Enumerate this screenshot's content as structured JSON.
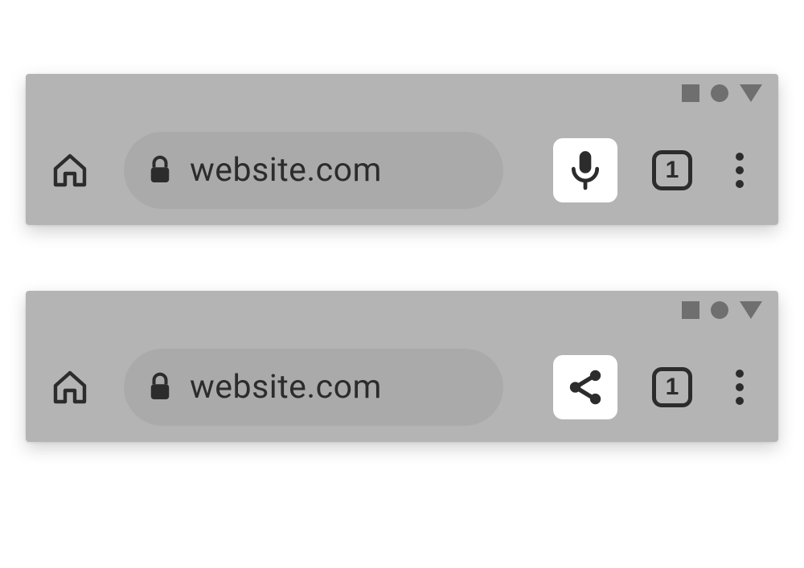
{
  "panels": [
    {
      "url": "website.com",
      "tab_count": "1",
      "highlighted_action": "microphone"
    },
    {
      "url": "website.com",
      "tab_count": "1",
      "highlighted_action": "share"
    }
  ],
  "icons": {
    "home": "home-icon",
    "lock": "lock-icon",
    "microphone": "microphone-icon",
    "share": "share-icon",
    "tabs": "tabs-icon",
    "menu": "more-vert-icon",
    "status_square": "status-square-icon",
    "status_circle": "status-circle-icon",
    "status_triangle": "status-triangle-icon"
  },
  "colors": {
    "panel_bg": "#b4b4b4",
    "omnibox_bg": "#aaaaaa",
    "ink": "#2c2c2c",
    "status": "#6f6f6f",
    "highlight_bg": "#ffffff"
  }
}
